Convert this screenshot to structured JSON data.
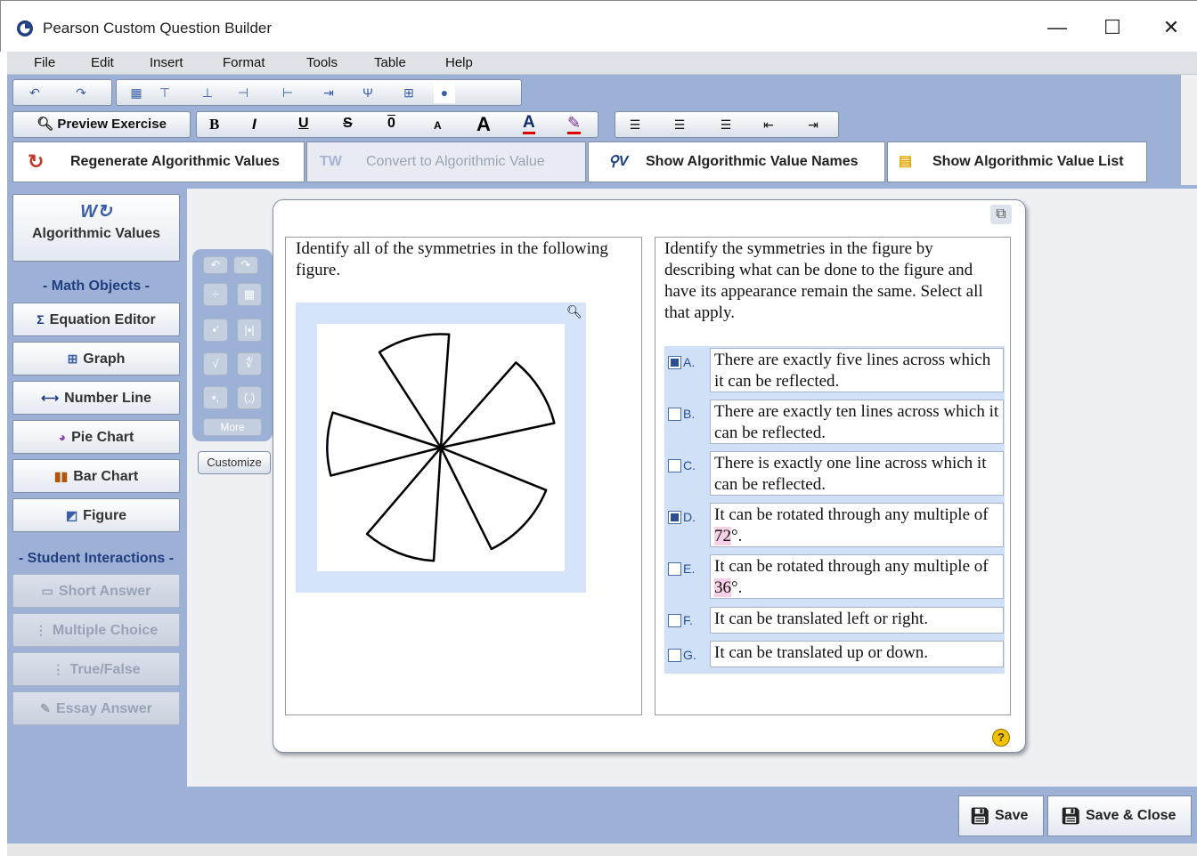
{
  "window": {
    "title": "Pearson Custom Question Builder",
    "minimize_glyph": "—",
    "maximize_glyph": "☐",
    "close_glyph": "✕"
  },
  "menu": [
    "File",
    "Edit",
    "Insert",
    "Format",
    "Tools",
    "Table",
    "Help"
  ],
  "toolbar": {
    "preview_label": "Preview Exercise",
    "bold": "B",
    "italic": "I",
    "underline": "U",
    "strike": "S",
    "overline": "0",
    "font_smaller": "A",
    "font_larger": "A",
    "font_color": "A",
    "highlight_glyph": "✎",
    "regenerate_label": "Regenerate Algorithmic Values",
    "convert_label": "Convert to Algorithmic Value",
    "show_names_label": "Show Algorithmic Value Names",
    "show_list_label": "Show Algorithmic Value List"
  },
  "left_panel": {
    "algorithmic_values_label": "Algorithmic Values",
    "math_objects_heading": "- Math Objects -",
    "equation_editor": "Equation Editor",
    "graph": "Graph",
    "number_line": "Number Line",
    "pie_chart": "Pie Chart",
    "bar_chart": "Bar Chart",
    "figure": "Figure",
    "student_interactions_heading": "- Student Interactions -",
    "short_answer": "Short Answer",
    "multiple_choice": "Multiple Choice",
    "true_false": "True/False",
    "essay_answer": "Essay Answer"
  },
  "palette": {
    "more_label": "More",
    "customize_label": "Customize"
  },
  "question": {
    "prompt": "Identify all of the symmetries in the following figure.",
    "instructions": "Identify the symmetries in the figure by describing what can be done to the figure and have its appearance remain the same. Select all that apply.",
    "choices": [
      {
        "letter": "A.",
        "text": "There are exactly five lines across which it can be reflected.",
        "checked": true
      },
      {
        "letter": "B.",
        "text": "There are exactly ten lines across which it can be reflected.",
        "checked": false
      },
      {
        "letter": "C.",
        "text": "There is exactly one line across which it can be reflected.",
        "checked": false
      },
      {
        "letter": "D.",
        "text_before": "It can be rotated through any multiple of ",
        "value": "72",
        "text_after": "°.",
        "checked": true
      },
      {
        "letter": "E.",
        "text_before": "It can be rotated through any multiple of ",
        "value": "36",
        "text_after": "°.",
        "checked": false
      },
      {
        "letter": "F.",
        "text": "It can be translated left or right.",
        "checked": false
      },
      {
        "letter": "G.",
        "text": "It can be translated up or down.",
        "checked": false
      }
    ],
    "help_glyph": "?"
  },
  "footer": {
    "save_label": "Save",
    "save_close_label": "Save & Close"
  },
  "colors": {
    "toolbar_bg": "#9db0d6",
    "workspace_bg": "#eef0f4",
    "choice_bg": "#cfe0f7",
    "highlight": "#f5d0e6",
    "heading_blue": "#1f3f80"
  }
}
